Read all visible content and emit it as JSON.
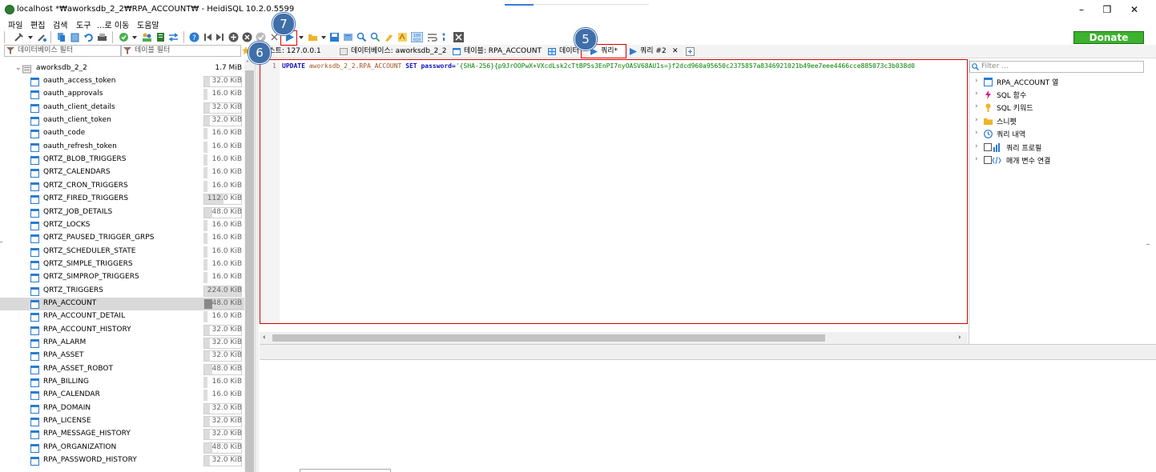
{
  "window": {
    "title": "localhost *₩aworksdb_2_2₩RPA_ACCOUNT₩ - HeidiSQL 10.2.0.5599",
    "min": "–",
    "max": "❒",
    "close": "✕"
  },
  "menu": [
    "파일",
    "편집",
    "검색",
    "도구",
    "...로 이동",
    "도움말"
  ],
  "toolbar": {
    "donate": "Donate"
  },
  "filters": {
    "db_filter": "데이터베이스 필터",
    "table_filter": "테이블 필터"
  },
  "tree": {
    "database": {
      "name": "aworksdb_2_2",
      "size": "1.7 MiB"
    },
    "tables": [
      {
        "name": "oauth_access_token",
        "size": "32.0 KiB",
        "fill": 0.15
      },
      {
        "name": "oauth_approvals",
        "size": "16.0 KiB",
        "fill": 0.0
      },
      {
        "name": "oauth_client_details",
        "size": "32.0 KiB",
        "fill": 0.15
      },
      {
        "name": "oauth_client_token",
        "size": "32.0 KiB",
        "fill": 0.15
      },
      {
        "name": "oauth_code",
        "size": "16.0 KiB",
        "fill": 0.0
      },
      {
        "name": "oauth_refresh_token",
        "size": "16.0 KiB",
        "fill": 0.0
      },
      {
        "name": "QRTZ_BLOB_TRIGGERS",
        "size": "16.0 KiB",
        "fill": 0.0
      },
      {
        "name": "QRTZ_CALENDARS",
        "size": "16.0 KiB",
        "fill": 0.0
      },
      {
        "name": "QRTZ_CRON_TRIGGERS",
        "size": "16.0 KiB",
        "fill": 0.0
      },
      {
        "name": "QRTZ_FIRED_TRIGGERS",
        "size": "112.0 KiB",
        "fill": 0.5
      },
      {
        "name": "QRTZ_JOB_DETAILS",
        "size": "48.0 KiB",
        "fill": 0.2
      },
      {
        "name": "QRTZ_LOCKS",
        "size": "16.0 KiB",
        "fill": 0.0
      },
      {
        "name": "QRTZ_PAUSED_TRIGGER_GRPS",
        "size": "16.0 KiB",
        "fill": 0.0
      },
      {
        "name": "QRTZ_SCHEDULER_STATE",
        "size": "16.0 KiB",
        "fill": 0.0
      },
      {
        "name": "QRTZ_SIMPLE_TRIGGERS",
        "size": "16.0 KiB",
        "fill": 0.0
      },
      {
        "name": "QRTZ_SIMPROP_TRIGGERS",
        "size": "16.0 KiB",
        "fill": 0.0
      },
      {
        "name": "QRTZ_TRIGGERS",
        "size": "224.0 KiB",
        "fill": 1.0
      },
      {
        "name": "RPA_ACCOUNT",
        "size": "48.0 KiB",
        "fill": 0.2,
        "selected": true
      },
      {
        "name": "RPA_ACCOUNT_DETAIL",
        "size": "16.0 KiB",
        "fill": 0.0
      },
      {
        "name": "RPA_ACCOUNT_HISTORY",
        "size": "32.0 KiB",
        "fill": 0.15
      },
      {
        "name": "RPA_ALARM",
        "size": "32.0 KiB",
        "fill": 0.15
      },
      {
        "name": "RPA_ASSET",
        "size": "32.0 KiB",
        "fill": 0.15
      },
      {
        "name": "RPA_ASSET_ROBOT",
        "size": "48.0 KiB",
        "fill": 0.2
      },
      {
        "name": "RPA_BILLING",
        "size": "16.0 KiB",
        "fill": 0.0
      },
      {
        "name": "RPA_CALENDAR",
        "size": "16.0 KiB",
        "fill": 0.0
      },
      {
        "name": "RPA_DOMAIN",
        "size": "32.0 KiB",
        "fill": 0.15
      },
      {
        "name": "RPA_LICENSE",
        "size": "32.0 KiB",
        "fill": 0.15
      },
      {
        "name": "RPA_MESSAGE_HISTORY",
        "size": "32.0 KiB",
        "fill": 0.15
      },
      {
        "name": "RPA_ORGANIZATION",
        "size": "48.0 KiB",
        "fill": 0.2
      },
      {
        "name": "RPA_PASSWORD_HISTORY",
        "size": "32.0 KiB",
        "fill": 0.15
      }
    ]
  },
  "tabs": {
    "host": "호스트: 127.0.0.1",
    "database": "데이터베이스: aworksdb_2_2",
    "table": "테이블: RPA_ACCOUNT",
    "data": "데이터",
    "query": "쿼리*",
    "query2": "쿼리 #2",
    "close": "✕"
  },
  "editor": {
    "line_number": "1",
    "sql_update": "UPDATE",
    "sql_table": "aworksdb_2_2.RPA_ACCOUNT",
    "sql_set": "SET",
    "sql_col": "password=",
    "sql_value": "'{SHA-256}{p9JrOOPwX+VXcdLsk2cTtBP5s3EnPI7nyOASV68AU1s=}f2dcd960a95650c2375857a8346921021b49ee7eee4466cce885073c3b038d0"
  },
  "helper": {
    "filter_placeholder": "Filter ...",
    "items": [
      "RPA_ACCOUNT 열",
      "SQL 함수",
      "SQL 키워드",
      "스니펫",
      "쿼리 내역",
      "쿼리 프로필",
      "매개 변수 연결"
    ]
  },
  "annotations": {
    "a5": "5",
    "a6": "6",
    "a7": "7"
  },
  "colors": {
    "annotation": "#3f6fa9",
    "highlight": "#dd0000",
    "donate": "#3cb22e",
    "table_icon": "#2a7bd1"
  }
}
